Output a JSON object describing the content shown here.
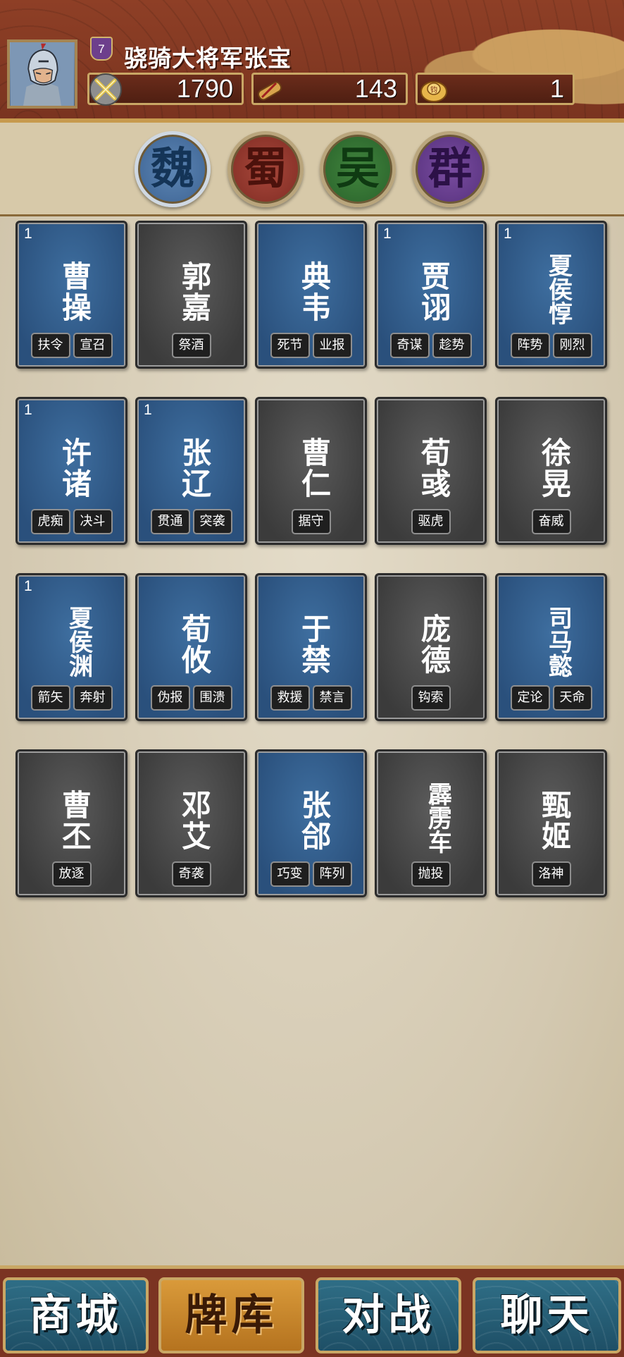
{
  "player": {
    "level": "7",
    "name": "骁骑大将军张宝",
    "stats": [
      {
        "icon": "crossed-swords-icon",
        "value": "1790"
      },
      {
        "icon": "scroll-icon",
        "value": "143"
      },
      {
        "icon": "gold-ingot-icon",
        "value": "1"
      }
    ]
  },
  "factions": [
    {
      "label": "魏",
      "color": "#3c6292",
      "selected": true
    },
    {
      "label": "蜀",
      "color": "#7e2a22",
      "selected": false
    },
    {
      "label": "吴",
      "color": "#28602a",
      "selected": false
    },
    {
      "label": "群",
      "color": "#55307c",
      "selected": false
    }
  ],
  "cards": [
    {
      "name": "曹操",
      "count": "1",
      "owned": true,
      "skills": [
        "扶令",
        "宣召"
      ]
    },
    {
      "name": "郭嘉",
      "count": "",
      "owned": false,
      "skills": [
        "祭酒"
      ]
    },
    {
      "name": "典韦",
      "count": "",
      "owned": true,
      "skills": [
        "死节",
        "业报"
      ]
    },
    {
      "name": "贾诩",
      "count": "1",
      "owned": true,
      "skills": [
        "奇谋",
        "趁势"
      ]
    },
    {
      "name": "夏侯惇",
      "count": "1",
      "owned": true,
      "skills": [
        "阵势",
        "刚烈"
      ]
    },
    {
      "name": "许诸",
      "count": "1",
      "owned": true,
      "skills": [
        "虎痴",
        "决斗"
      ]
    },
    {
      "name": "张辽",
      "count": "1",
      "owned": true,
      "skills": [
        "贯通",
        "突袭"
      ]
    },
    {
      "name": "曹仁",
      "count": "",
      "owned": false,
      "skills": [
        "据守"
      ]
    },
    {
      "name": "荀彧",
      "count": "",
      "owned": false,
      "skills": [
        "驱虎"
      ]
    },
    {
      "name": "徐晃",
      "count": "",
      "owned": false,
      "skills": [
        "奋威"
      ]
    },
    {
      "name": "夏侯渊",
      "count": "1",
      "owned": true,
      "skills": [
        "箭矢",
        "奔射"
      ]
    },
    {
      "name": "荀攸",
      "count": "",
      "owned": true,
      "skills": [
        "伪报",
        "围溃"
      ]
    },
    {
      "name": "于禁",
      "count": "",
      "owned": true,
      "skills": [
        "救援",
        "禁言"
      ]
    },
    {
      "name": "庞德",
      "count": "",
      "owned": false,
      "skills": [
        "钩索"
      ]
    },
    {
      "name": "司马懿",
      "count": "",
      "owned": true,
      "skills": [
        "定论",
        "天命"
      ]
    },
    {
      "name": "曹丕",
      "count": "",
      "owned": false,
      "skills": [
        "放逐"
      ]
    },
    {
      "name": "邓艾",
      "count": "",
      "owned": false,
      "skills": [
        "奇袭"
      ]
    },
    {
      "name": "张郃",
      "count": "",
      "owned": true,
      "skills": [
        "巧变",
        "阵列"
      ]
    },
    {
      "name": "霹雳车",
      "count": "",
      "owned": false,
      "skills": [
        "抛投"
      ]
    },
    {
      "name": "甄姬",
      "count": "",
      "owned": false,
      "skills": [
        "洛神"
      ]
    }
  ],
  "nav": [
    {
      "label": "商城",
      "active": false
    },
    {
      "label": "牌库",
      "active": true
    },
    {
      "label": "对战",
      "active": false
    },
    {
      "label": "聊天",
      "active": false
    }
  ]
}
